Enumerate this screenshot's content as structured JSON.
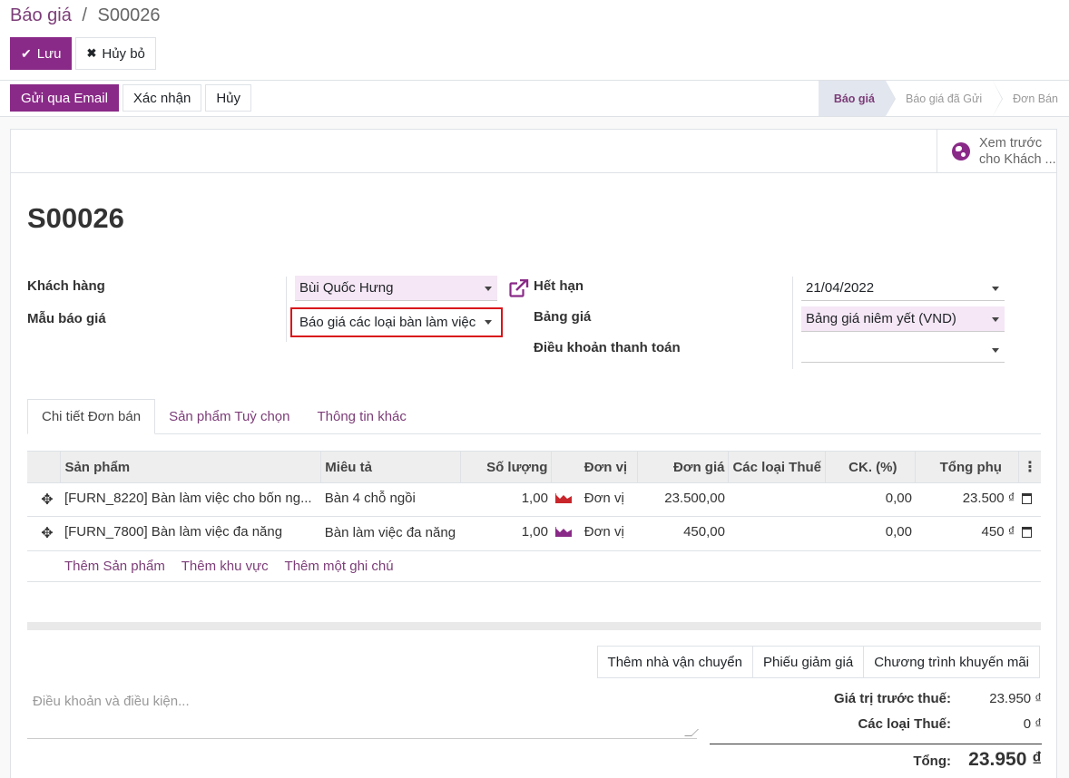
{
  "breadcrumb": {
    "parent": "Báo giá",
    "separator": "/",
    "current": "S00026"
  },
  "toolbar": {
    "save_label": "Lưu",
    "discard_label": "Hủy bỏ"
  },
  "statusbar": {
    "buttons": [
      "Gửi qua Email",
      "Xác nhận",
      "Hủy"
    ],
    "stages": [
      "Báo giá",
      "Báo giá đã Gửi",
      "Đơn Bán"
    ],
    "active_stage": "Báo giá"
  },
  "smart_button": {
    "line1": "Xem trước",
    "line2": "cho Khách ..."
  },
  "order": {
    "name": "S00026",
    "customer_label": "Khách hàng",
    "customer": "Bùi Quốc Hưng",
    "template_label": "Mẫu báo giá",
    "template": "Báo giá các loại bàn làm việc",
    "expiration_label": "Hết hạn",
    "expiration": "21/04/2022",
    "pricelist_label": "Bảng giá",
    "pricelist": "Bảng giá niêm yết (VND)",
    "payment_terms_label": "Điều khoản thanh toán",
    "payment_terms": ""
  },
  "tabs": [
    "Chi tiết Đơn bán",
    "Sản phẩm Tuỳ chọn",
    "Thông tin khác"
  ],
  "lines": {
    "headers": {
      "product": "Sản phẩm",
      "description": "Miêu tả",
      "qty": "Số lượng",
      "uom": "Đơn vị",
      "price": "Đơn giá",
      "taxes": "Các loại Thuế",
      "discount": "CK. (%)",
      "subtotal": "Tổng phụ"
    },
    "rows": [
      {
        "product": "[FURN_8220] Bàn làm việc cho bốn ng...",
        "description": "Bàn 4 chỗ ngồi",
        "qty": "1,00",
        "uom": "Đơn vị",
        "price": "23.500,00",
        "taxes": "",
        "discount": "0,00",
        "subtotal": "23.500 ₫",
        "forecast_color": "#c9262c"
      },
      {
        "product": "[FURN_7800] Bàn làm việc đa năng",
        "description": "Bàn làm việc đa năng",
        "qty": "1,00",
        "uom": "Đơn vị",
        "price": "450,00",
        "taxes": "",
        "discount": "0,00",
        "subtotal": "450 ₫",
        "forecast_color": "#8a2a88"
      }
    ],
    "add_links": [
      "Thêm Sản phẩm",
      "Thêm khu vực",
      "Thêm một ghi chú"
    ]
  },
  "footer_buttons": [
    "Thêm nhà vận chuyển",
    "Phiếu giảm giá",
    "Chương trình khuyến mãi"
  ],
  "terms_placeholder": "Điều khoản và điều kiện...",
  "totals": {
    "untaxed_label": "Giá trị trước thuế:",
    "untaxed": "23.950 ₫",
    "taxes_label": "Các loại Thuế:",
    "taxes": "0 ₫",
    "total_label": "Tổng:",
    "total": "23.950 ₫"
  },
  "colors": {
    "brand": "#8a2a88",
    "link": "#7c3d78",
    "highlight_border": "#d9141a"
  }
}
